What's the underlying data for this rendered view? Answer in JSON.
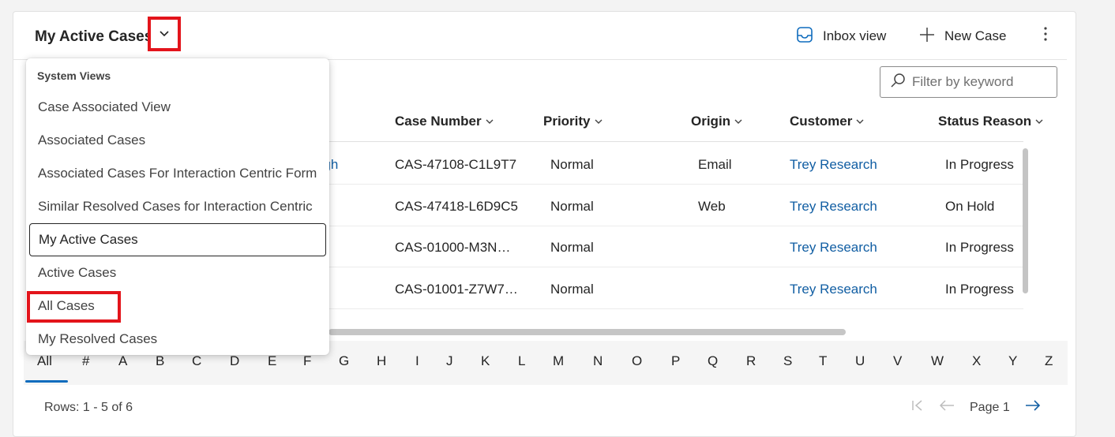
{
  "header": {
    "view_title": "My Active Cases",
    "inbox_label": "Inbox view",
    "new_case_label": "New Case"
  },
  "filter": {
    "placeholder": "Filter by keyword"
  },
  "columns": [
    "Case Number",
    "Priority",
    "Origin",
    "Customer",
    "Status Reason"
  ],
  "rows": [
    {
      "title_fragment": "ugh",
      "case_number": "CAS-47108-C1L9T7",
      "priority": "Normal",
      "origin": "Email",
      "customer": "Trey Research",
      "status": "In Progress"
    },
    {
      "title_fragment": "",
      "case_number": "CAS-47418-L6D9C5",
      "priority": "Normal",
      "origin": "Web",
      "customer": "Trey Research",
      "status": "On Hold"
    },
    {
      "title_fragment": "",
      "case_number": "CAS-01000-M3N…",
      "priority": "Normal",
      "origin": "",
      "customer": "Trey Research",
      "status": "In Progress"
    },
    {
      "title_fragment": "",
      "case_number": "CAS-01001-Z7W7…",
      "priority": "Normal",
      "origin": "",
      "customer": "Trey Research",
      "status": "In Progress"
    }
  ],
  "alphabet": [
    "All",
    "#",
    "A",
    "B",
    "C",
    "D",
    "E",
    "F",
    "G",
    "H",
    "I",
    "J",
    "K",
    "L",
    "M",
    "N",
    "O",
    "P",
    "Q",
    "R",
    "S",
    "T",
    "U",
    "V",
    "W",
    "X",
    "Y",
    "Z"
  ],
  "footer": {
    "rows_text": "Rows: 1 - 5 of 6",
    "page_text": "Page 1"
  },
  "dropdown": {
    "header": "System Views",
    "items": [
      "Case Associated View",
      "Associated Cases",
      "Associated Cases For Interaction Centric Form",
      "Similar Resolved Cases for Interaction Centric",
      "My Active Cases",
      "Active Cases",
      "All Cases",
      "My Resolved Cases"
    ],
    "selected": "My Active Cases",
    "highlighted": "All Cases"
  },
  "colors": {
    "accent": "#0f6cbd",
    "link": "#115ea3",
    "callout": "#e3141b"
  },
  "icons": [
    "chevron-down-icon",
    "inbox-icon",
    "plus-icon",
    "more-vertical-icon",
    "search-icon",
    "first-page-icon",
    "arrow-left-icon",
    "arrow-right-icon"
  ]
}
